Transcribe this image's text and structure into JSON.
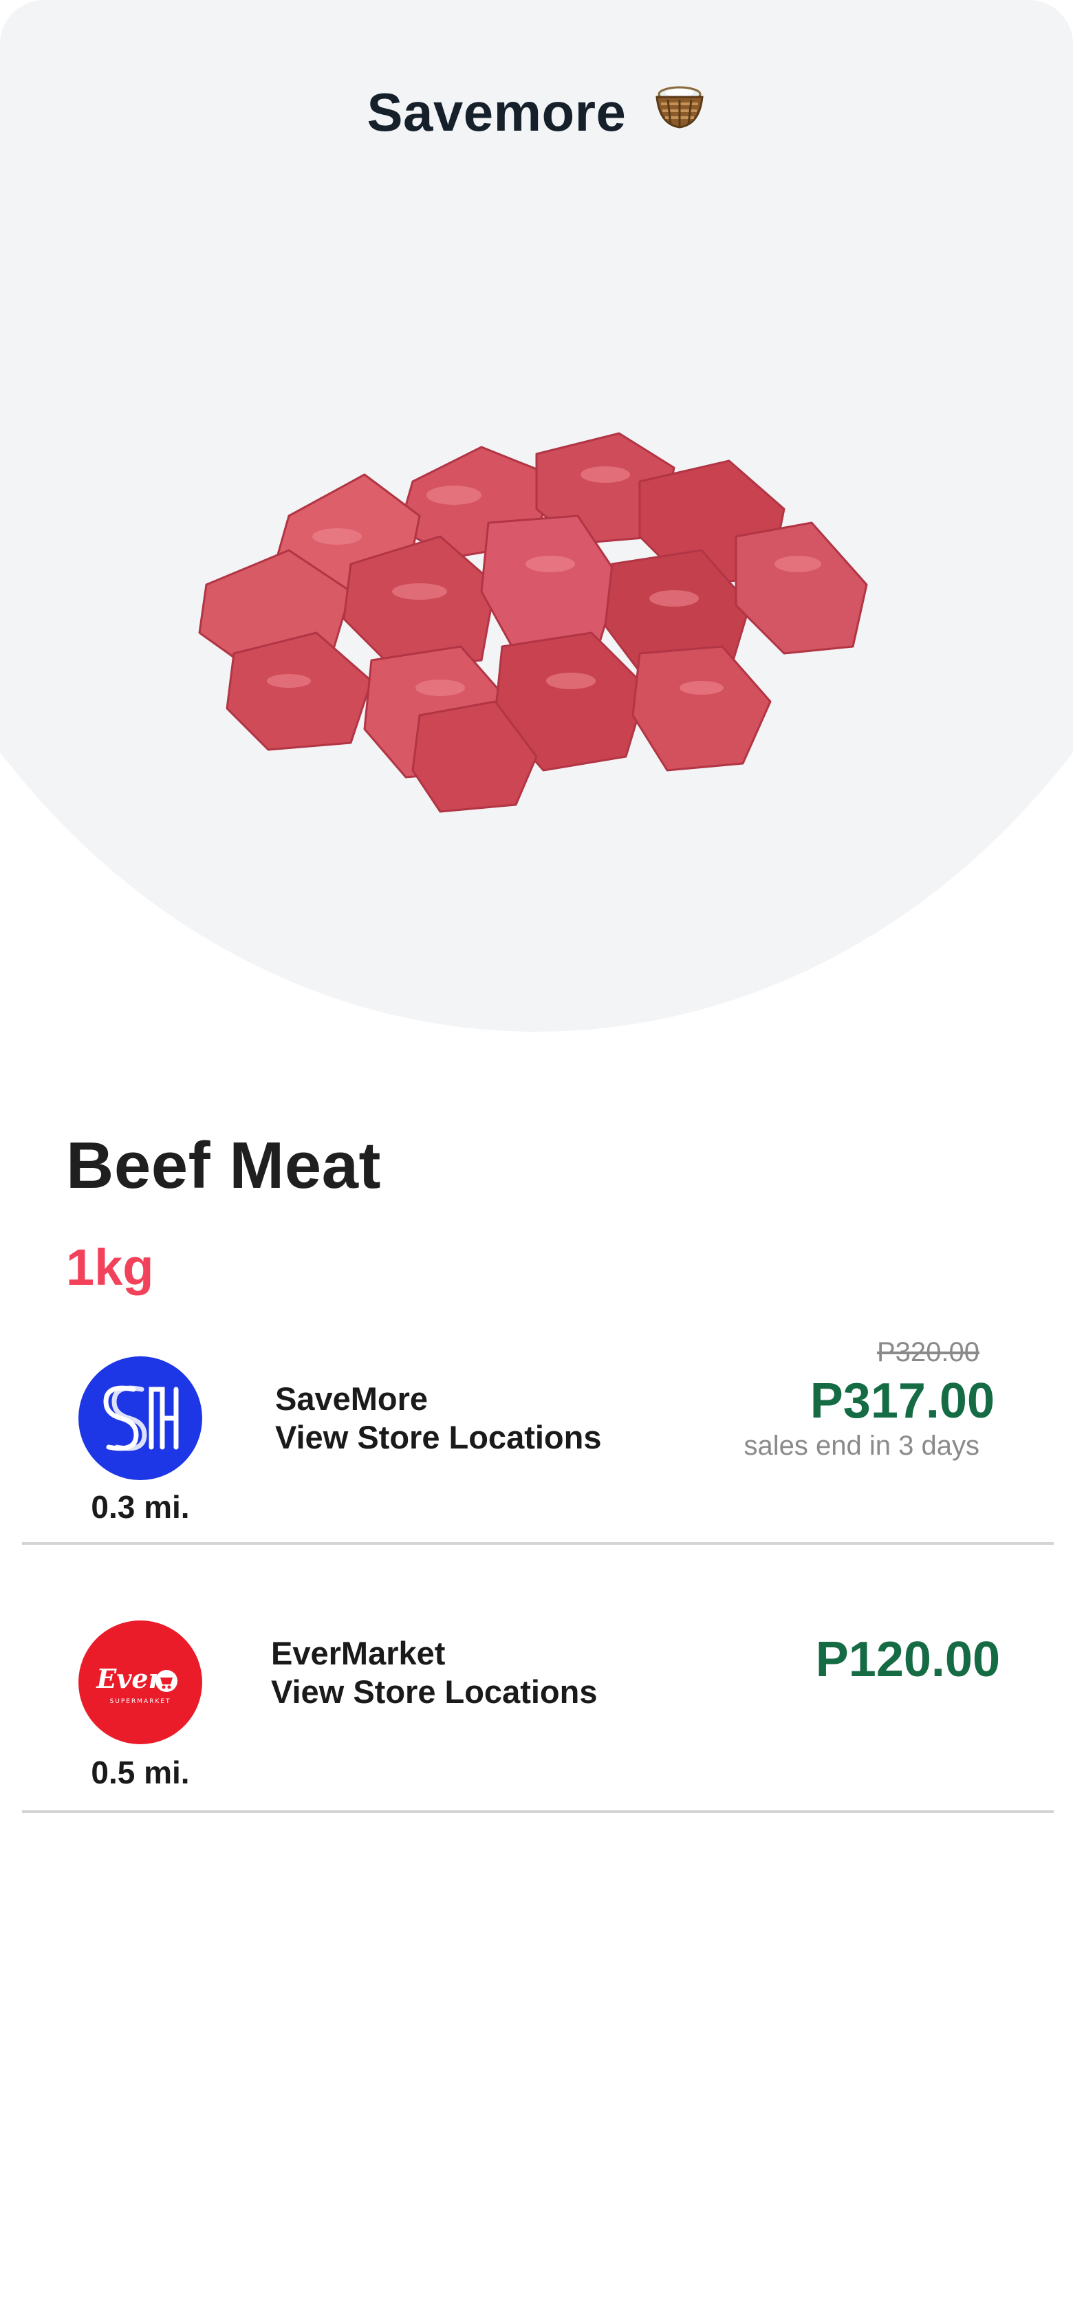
{
  "header": {
    "title": "Savemore",
    "basket_icon": "basket-icon"
  },
  "product": {
    "name": "Beef Meat",
    "size": "1kg",
    "image": "beef-cubes-image"
  },
  "stores": [
    {
      "name": "SaveMore",
      "link_label": "View Store Locations",
      "distance": "0.3 mi.",
      "old_price": "P320.00",
      "price": "P317.00",
      "sale_note": "sales end in 3 days",
      "logo": "sm-logo",
      "logo_color": "#1d36e6"
    },
    {
      "name": "EverMarket",
      "link_label": "View Store Locations",
      "distance": "0.5 mi.",
      "price": "P120.00",
      "logo": "ever-logo",
      "logo_color": "#ea1c2a",
      "logo_text": "Ever",
      "logo_subtext": "SUPERMARKET"
    }
  ],
  "colors": {
    "hero_bg": "#f3f4f6",
    "price_green": "#146b44",
    "size_red": "#f2415a"
  }
}
